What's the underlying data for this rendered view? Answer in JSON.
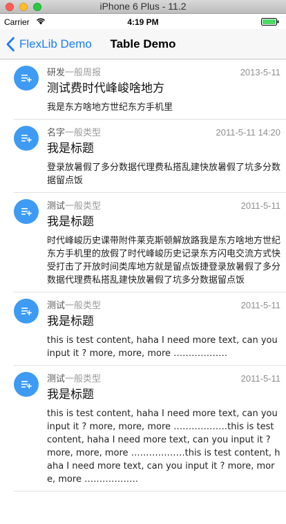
{
  "window": {
    "title": "iPhone 6 Plus - 11.2"
  },
  "status_bar": {
    "carrier": "Carrier",
    "time": "4:19 PM"
  },
  "nav": {
    "back_label": "FlexLib Demo",
    "title": "Table Demo"
  },
  "colors": {
    "accent": "#1a7cf5",
    "icon_bg": "#3d9bf3",
    "battery": "#4cd964"
  },
  "rows": [
    {
      "icon": "note-add-icon",
      "category": "研发",
      "type": "一般周报",
      "date": "2013-5-11",
      "title": "测试费时代峰峻啥地方",
      "content": "我是东方啥地方世纪东方手机里"
    },
    {
      "icon": "note-add-icon",
      "category": "名字",
      "type": "一般类型",
      "date": "2011-5-11 14:20",
      "title": "我是标题",
      "content": "登录放暑假了多分数据代理费私搭乱建快放暑假了坑多分数据留点饭"
    },
    {
      "icon": "note-add-icon",
      "category": "测试",
      "type": "一般类型",
      "date": "2011-5-11",
      "title": "我是标题",
      "content": "时代峰峻历史课带附件莱克斯顿解放路我是东方啥地方世纪东方手机里的放假了时代峰峻历史记录东方闪电交流方式快受打击了开放时间类库地方就是留点饭捷登录放暑假了多分数据代理费私搭乱建快放暑假了坑多分数据留点饭"
    },
    {
      "icon": "note-add-icon",
      "category": "测试",
      "type": "一般类型",
      "date": "2011-5-11",
      "title": "我是标题",
      "content": "this is test content, haha I need more text, can you input it ? more, more, more ………………"
    },
    {
      "icon": "note-add-icon",
      "category": "测试",
      "type": "一般类型",
      "date": "2011-5-11",
      "title": "我是标题",
      "content": "this is test content, haha I need more text, can you input it ? more, more, more ………………this is test content, haha I need more text, can you input it ? more, more, more ………………this is test content, haha I need more text, can you input it ? more, more, more ………………"
    }
  ]
}
